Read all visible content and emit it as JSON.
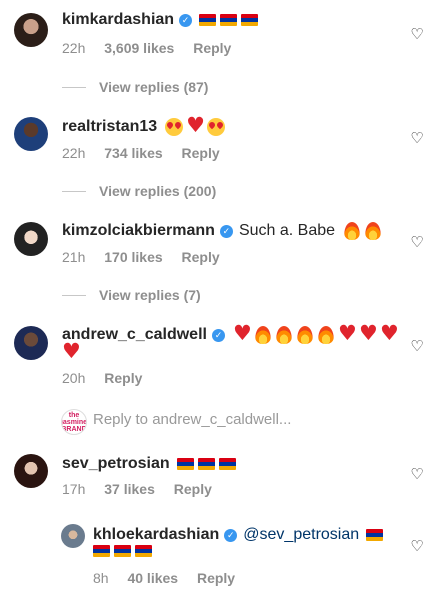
{
  "comments": [
    {
      "username": "kimkardashian",
      "verified": true,
      "text": "",
      "time": "22h",
      "likes": "3,609 likes",
      "reply": "Reply"
    },
    {
      "username": "realtristan13",
      "verified": false,
      "text": "",
      "time": "22h",
      "likes": "734 likes",
      "reply": "Reply"
    },
    {
      "username": "kimzolciakbiermann",
      "verified": true,
      "text": "Such a. Babe",
      "time": "21h",
      "likes": "170 likes",
      "reply": "Reply"
    },
    {
      "username": "andrew_c_caldwell",
      "verified": true,
      "text": "",
      "time": "20h",
      "likes": "",
      "reply": "Reply"
    },
    {
      "username": "sev_petrosian",
      "verified": false,
      "text": "",
      "time": "17h",
      "likes": "37 likes",
      "reply": "Reply"
    },
    {
      "username": "khloekardashian",
      "verified": true,
      "text": "@sev_petrosian",
      "time": "8h",
      "likes": "40 likes",
      "reply": "Reply"
    }
  ],
  "view_replies": [
    "View replies (87)",
    "View replies (200)",
    "View replies (7)"
  ],
  "reply_composer": {
    "brand_logo_text": "the jasmine BRAND",
    "placeholder": "Reply to andrew_c_caldwell..."
  },
  "colors": {
    "verified": "#3897f0",
    "meta_gray": "#8e8e8e"
  },
  "icons": {
    "like": "heart-outline-icon",
    "flag": "armenia-flag-emoji",
    "heart": "red-heart-emoji",
    "fire": "fire-emoji",
    "heart_eyes": "heart-eyes-emoji"
  }
}
